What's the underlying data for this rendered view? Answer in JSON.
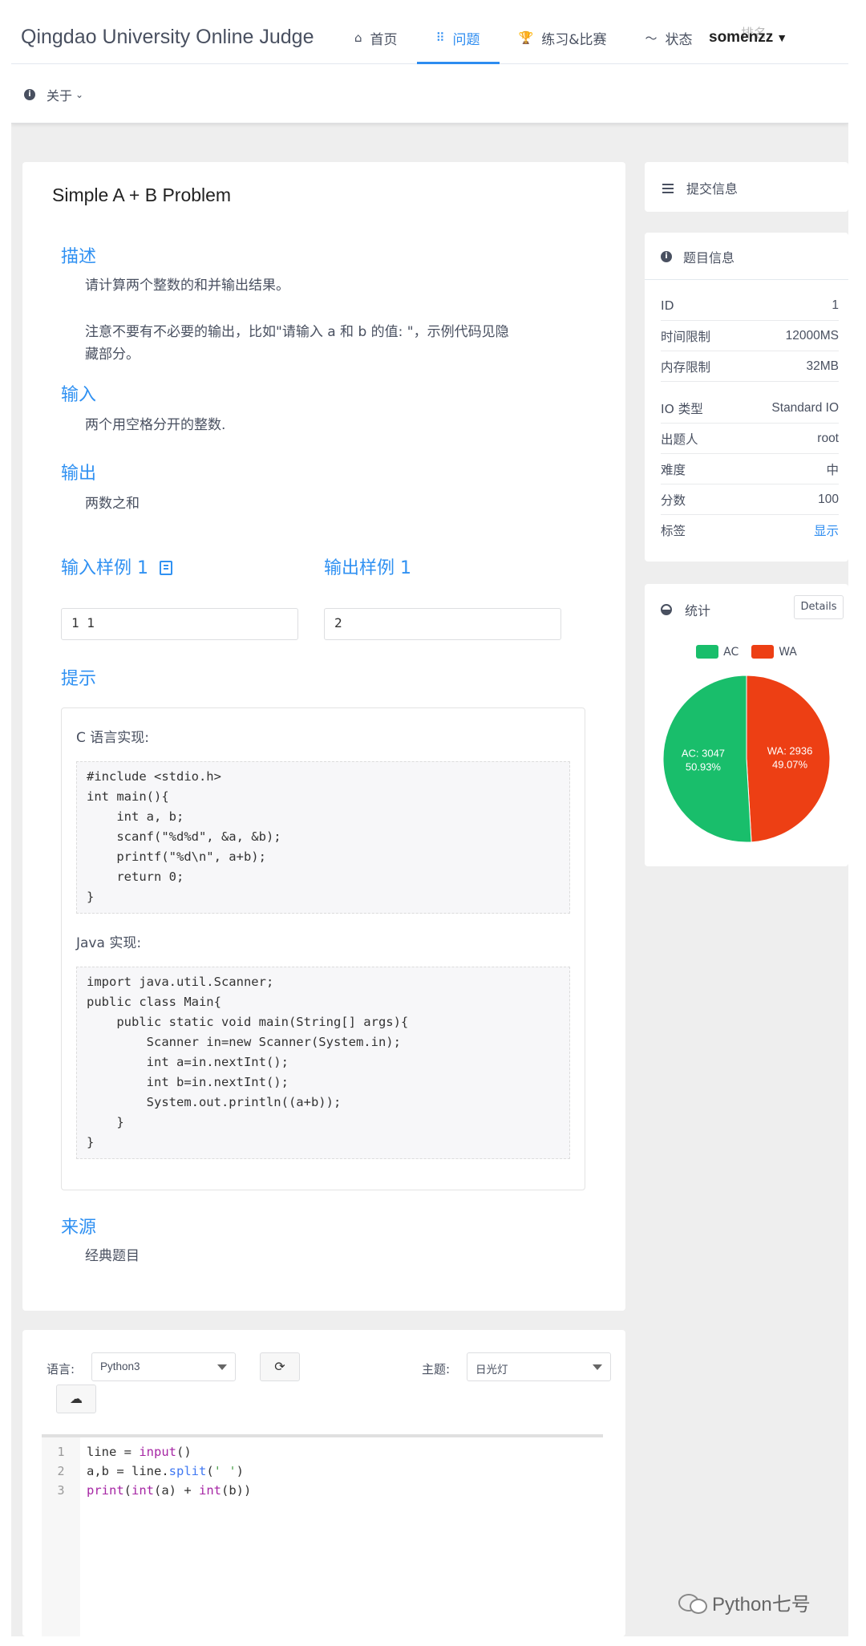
{
  "header": {
    "brand": "Qingdao University Online Judge",
    "nav": [
      {
        "icon": "home-icon",
        "glyph": "⌂",
        "label": "首页"
      },
      {
        "icon": "grid-icon",
        "glyph": "⠿",
        "label": "问题"
      },
      {
        "icon": "trophy-icon",
        "glyph": "🏆",
        "label": "练习&比赛"
      },
      {
        "icon": "pulse-icon",
        "glyph": "〜",
        "label": "状态"
      }
    ],
    "rank_label_partial": "排名",
    "user": "somenzz",
    "about": "关于"
  },
  "problem": {
    "title": "Simple A + B Problem",
    "desc_title": "描述",
    "desc_p1": "请计算两个整数的和并输出结果。",
    "desc_p2_line1": "注意不要有不必要的输出，比如\"请输入 a 和 b 的值: \"，示例代码见隐",
    "desc_p2_line2": "藏部分。",
    "input_title": "输入",
    "input_text": "两个用空格分开的整数.",
    "output_title": "输出",
    "output_text": "两数之和",
    "sample_in_title": "输入样例 1",
    "sample_in": "1 1",
    "sample_out_title": "输出样例 1",
    "sample_out": "2",
    "hint_title": "提示",
    "c_label": "C 语言实现:",
    "c_code": "#include <stdio.h>\nint main(){\n    int a, b;\n    scanf(\"%d%d\", &a, &b);\n    printf(\"%d\\n\", a+b);\n    return 0;\n}",
    "java_label": "Java 实现:",
    "java_code": "import java.util.Scanner;\npublic class Main{\n    public static void main(String[] args){\n        Scanner in=new Scanner(System.in);\n        int a=in.nextInt();\n        int b=in.nextInt();\n        System.out.println((a+b));\n    }\n}",
    "source_title": "来源",
    "source_text": "经典题目"
  },
  "sidebar": {
    "submit_label": "提交信息",
    "info_title": "题目信息",
    "info_rows": [
      {
        "k": "ID",
        "v": "1"
      },
      {
        "k": "时间限制",
        "v": "12000MS"
      },
      {
        "k": "内存限制",
        "v": "32MB"
      },
      {
        "k": "IO 类型",
        "v": "Standard IO"
      },
      {
        "k": "出题人",
        "v": "root"
      },
      {
        "k": "难度",
        "v": "中"
      },
      {
        "k": "分数",
        "v": "100"
      },
      {
        "k": "标签",
        "v": "显示"
      }
    ],
    "stat_title": "统计",
    "details_label": "Details"
  },
  "chart_data": {
    "type": "pie",
    "categories": [
      "AC",
      "WA"
    ],
    "values": [
      3047,
      2936
    ],
    "labels": [
      "AC: 3047",
      "WA: 2936"
    ],
    "percents": [
      "50.93%",
      "49.07%"
    ],
    "colors": [
      "#19be6b",
      "#ed3f14"
    ],
    "legend": "top"
  },
  "editor": {
    "lang_label": "语言:",
    "lang_value": "Python3",
    "theme_label": "主题:",
    "theme_value": "日光灯",
    "line_numbers": [
      "1",
      "2",
      "3"
    ]
  },
  "watermark": "Python七号"
}
